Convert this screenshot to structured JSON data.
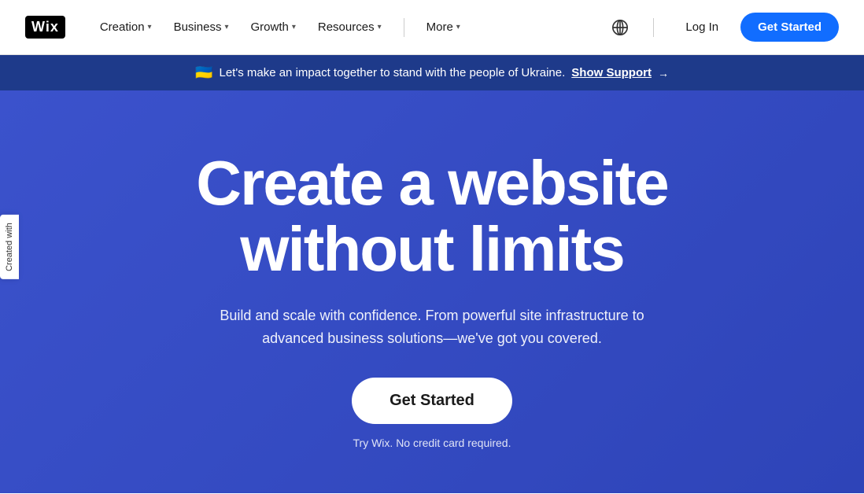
{
  "logo": {
    "text": "Wix"
  },
  "navbar": {
    "items": [
      {
        "label": "Creation",
        "has_chevron": true
      },
      {
        "label": "Business",
        "has_chevron": true
      },
      {
        "label": "Growth",
        "has_chevron": true
      },
      {
        "label": "Resources",
        "has_chevron": true
      },
      {
        "label": "More",
        "has_chevron": true
      }
    ],
    "login_label": "Log In",
    "get_started_label": "Get Started"
  },
  "banner": {
    "flag_emoji": "🇺🇦",
    "message": "Let's make an impact together to stand with the people of Ukraine.",
    "link_text": "Show Support",
    "arrow": "→"
  },
  "hero": {
    "title_line1": "Create a website",
    "title_line2": "without limits",
    "subtitle": "Build and scale with confidence. From powerful site infrastructure to advanced business solutions—we've got you covered.",
    "cta_label": "Get Started",
    "note": "Try Wix. No credit card required."
  },
  "side_tab": {
    "text": "Created with"
  },
  "icons": {
    "globe": "🌐",
    "chevron_down": "▾"
  }
}
